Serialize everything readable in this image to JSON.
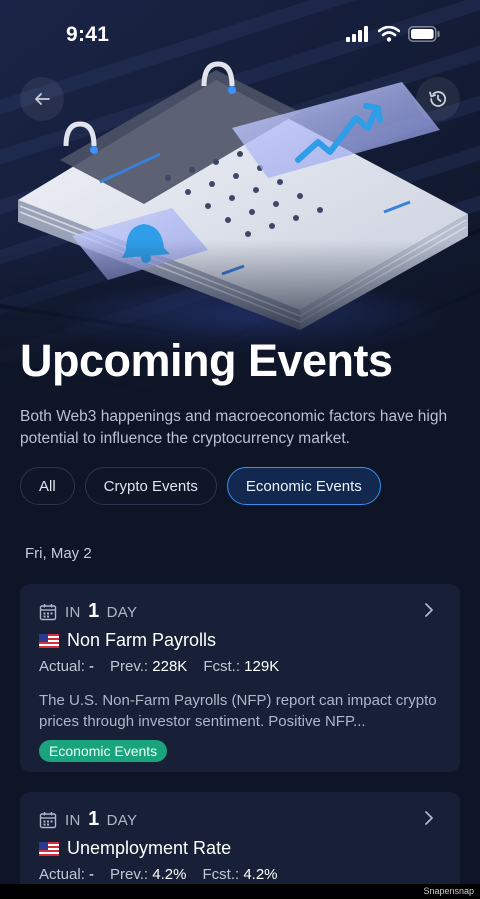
{
  "status_bar": {
    "time": "9:41"
  },
  "header": {
    "back_icon": "arrow-left-icon",
    "history_icon": "history-icon"
  },
  "hero": {
    "title": "Upcoming Events",
    "description": "Both Web3 happenings and macroeconomic factors have high potential to influence the cryptocurrency market."
  },
  "filters": [
    {
      "label": "All",
      "active": false
    },
    {
      "label": "Crypto Events",
      "active": false
    },
    {
      "label": "Economic Events",
      "active": true
    }
  ],
  "date_group": "Fri, May 2",
  "events": [
    {
      "in_prefix": "IN",
      "in_num": "1",
      "in_unit": "DAY",
      "name": "Non Farm Payrolls",
      "actual_label": "Actual:",
      "actual_value": "-",
      "prev_label": "Prev.:",
      "prev_value": "228K",
      "fcst_label": "Fcst.:",
      "fcst_value": "129K",
      "description": "The U.S. Non-Farm Payrolls (NFP) report can impact crypto prices through investor sentiment. Positive NFP...",
      "tag": "Economic Events"
    },
    {
      "in_prefix": "IN",
      "in_num": "1",
      "in_unit": "DAY",
      "name": "Unemployment Rate",
      "actual_label": "Actual:",
      "actual_value": "-",
      "prev_label": "Prev.:",
      "prev_value": "4.2%",
      "fcst_label": "Fcst.:",
      "fcst_value": "4.2%"
    }
  ],
  "watermark": "Snapensnap",
  "colors": {
    "accent": "#3d8ef0",
    "tag_green": "#1aa47d",
    "card_bg": "#172036",
    "page_bg": "#0e1527"
  }
}
